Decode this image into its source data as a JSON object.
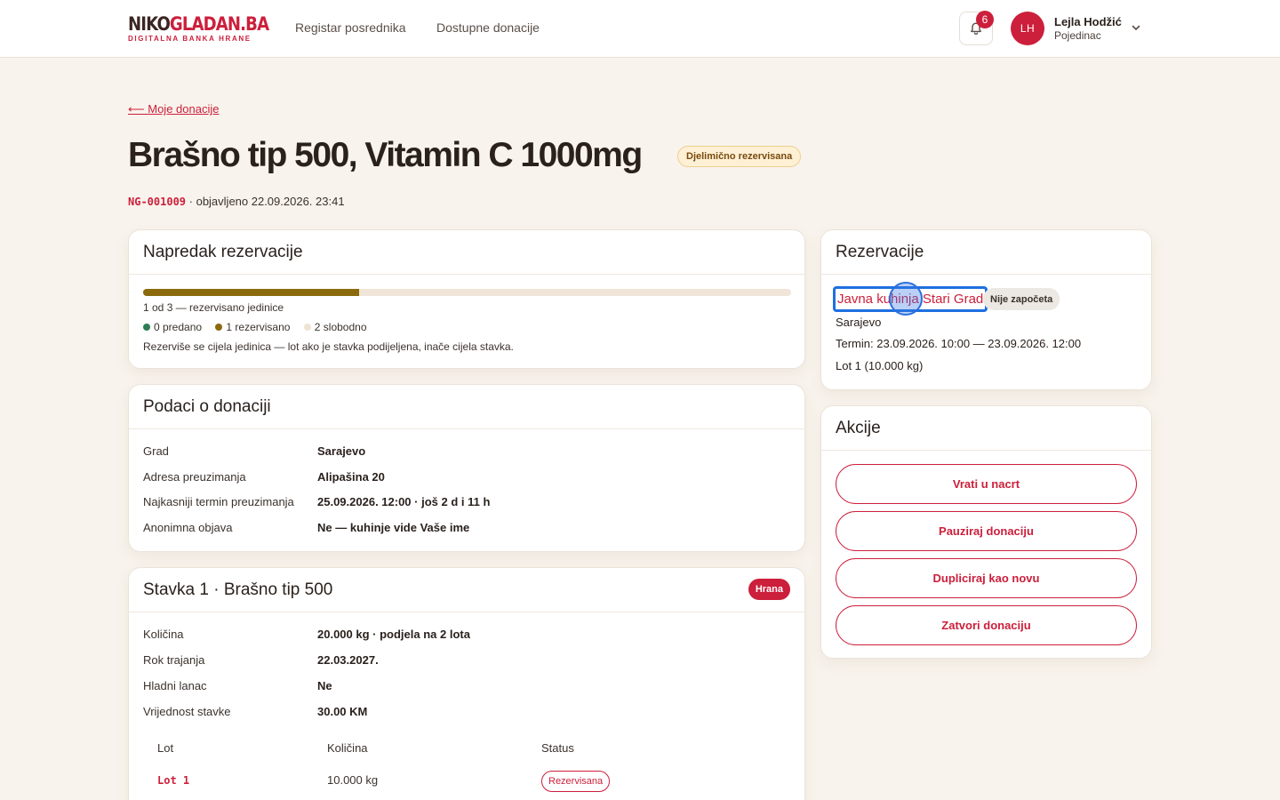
{
  "header": {
    "logo_main_dark": "NIKO",
    "logo_main_red": "GLADAN.BA",
    "logo_sub": "DIGITALNA BANKA HRANE",
    "nav": [
      "Registar posrednika",
      "Dostupne donacije"
    ],
    "notification_count": "6",
    "user_initials": "LH",
    "user_name": "Lejla Hodžić",
    "user_role": "Pojedinac"
  },
  "page": {
    "back_link": "⟵ Moje donacije",
    "title": "Brašno tip 500, Vitamin C 1000mg",
    "status": "Djelimično rezervisana",
    "code": "NG-001009",
    "published": " · objavljeno 22.09.2026. 23:41"
  },
  "progress": {
    "heading": "Napredak rezervacije",
    "fraction_reserved": 0.333,
    "summary": "1 od 3 — rezervisano jedinice",
    "legend": [
      {
        "label": "0 predano",
        "color": "#2f7d55"
      },
      {
        "label": "1 rezervisano",
        "color": "#8a6a0c"
      },
      {
        "label": "2 slobodno",
        "color": "#efe3d3"
      }
    ],
    "note": "Rezerviše se cijela jedinica — lot ako je stavka podijeljena, inače cijela stavka."
  },
  "donation": {
    "heading": "Podaci o donaciji",
    "rows": [
      {
        "k": "Grad",
        "v": "Sarajevo"
      },
      {
        "k": "Adresa preuzimanja",
        "v": "Alipašina 20"
      },
      {
        "k": "Najkasniji termin preuzimanja",
        "v": "25.09.2026. 12:00 · još 2 d i 11 h"
      },
      {
        "k": "Anonimna objava",
        "v": "Ne — kuhinje vide Vaše ime"
      }
    ]
  },
  "item": {
    "heading": "Stavka 1 · Brašno tip 500",
    "tag": "Hrana",
    "rows": [
      {
        "k": "Količina",
        "v": "20.000 kg · podjela na 2 lota"
      },
      {
        "k": "Rok trajanja",
        "v": "22.03.2027."
      },
      {
        "k": "Hladni lanac",
        "v": "Ne"
      },
      {
        "k": "Vrijednost stavke",
        "v": "30.00 KM"
      }
    ],
    "lot_headers": [
      "Lot",
      "Količina",
      "Status"
    ],
    "lots": [
      {
        "lot": "Lot 1",
        "qty": "10.000 kg",
        "status": "Rezervisana"
      }
    ]
  },
  "reservations": {
    "heading": "Rezervacije",
    "entries": [
      {
        "kitchen": "Javna kuhinja Stari Grad",
        "state": "Nije započeta",
        "city": "Sarajevo",
        "slot": "Termin: 23.09.2026. 10:00 — 23.09.2026. 12:00",
        "lot": "Lot 1 (10.000 kg)"
      }
    ]
  },
  "actions": {
    "heading": "Akcije",
    "buttons": [
      "Vrati u nacrt",
      "Pauziraj donaciju",
      "Dupliciraj kao novu",
      "Zatvori donaciju"
    ]
  }
}
